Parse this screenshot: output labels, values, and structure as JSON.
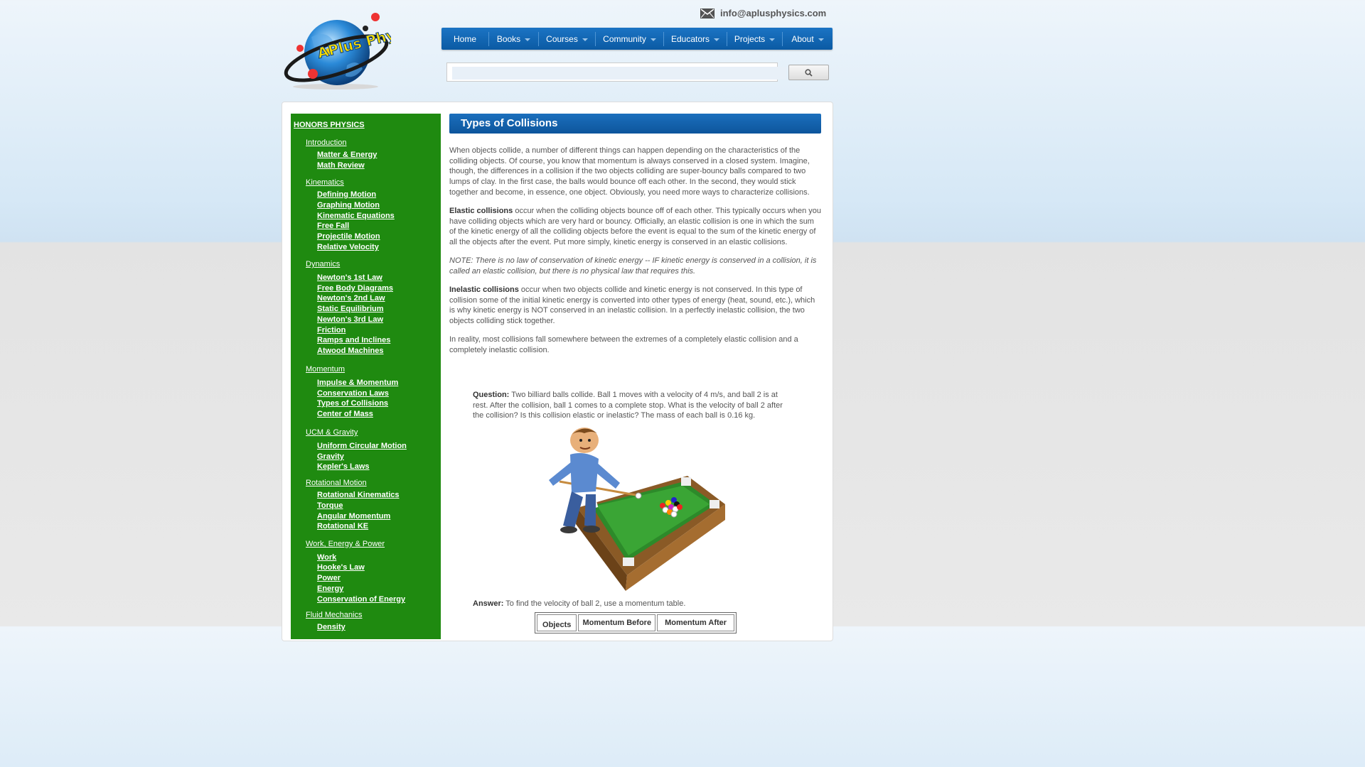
{
  "header": {
    "logo_text": "APlus Physics .com",
    "email": "info@aplusphysics.com"
  },
  "nav": {
    "items": [
      {
        "label": "Home",
        "dropdown": false
      },
      {
        "label": "Books",
        "dropdown": true
      },
      {
        "label": "Courses",
        "dropdown": true
      },
      {
        "label": "Community",
        "dropdown": true
      },
      {
        "label": "Educators",
        "dropdown": true
      },
      {
        "label": "Projects",
        "dropdown": true
      },
      {
        "label": "About",
        "dropdown": true
      }
    ]
  },
  "search": {
    "value": "",
    "placeholder": ""
  },
  "sidebar": {
    "title": "HONORS PHYSICS",
    "sections": [
      {
        "label": "Introduction",
        "items": [
          "Matter & Energy",
          "Math Review"
        ]
      },
      {
        "label": "Kinematics",
        "items": [
          "Defining Motion",
          "Graphing Motion",
          "Kinematic Equations",
          "Free Fall",
          "Projectile Motion",
          "Relative Velocity"
        ]
      },
      {
        "label": "Dynamics",
        "items": [
          "Newton's 1st Law",
          "Free Body Diagrams",
          "Newton's 2nd Law",
          "Static Equilibrium",
          "Newton's 3rd Law",
          "Friction",
          "Ramps and Inclines",
          "Atwood Machines"
        ]
      },
      {
        "label": "Momentum",
        "items": [
          "Impulse & Momentum",
          "Conservation Laws",
          "Types of Collisions",
          "Center of Mass"
        ]
      },
      {
        "label": "UCM & Gravity",
        "items": [
          "Uniform Circular Motion",
          "Gravity",
          "Kepler's Laws"
        ]
      },
      {
        "label": "Rotational Motion",
        "items": [
          "Rotational Kinematics",
          "Torque",
          "Angular Momentum",
          "Rotational KE"
        ]
      },
      {
        "label": "Work, Energy & Power",
        "items": [
          "Work",
          "Hooke's Law",
          "Power",
          "Energy",
          "Conservation of Energy"
        ]
      },
      {
        "label": "Fluid Mechanics",
        "items": [
          "Density"
        ]
      }
    ]
  },
  "main": {
    "title": "Types of Collisions",
    "intro": "When objects collide, a number of different things can happen depending on the characteristics of the colliding objects. Of course, you know that momentum is always conserved in a closed system. Imagine, though, the differences in a collision if the two objects colliding are super-bouncy balls compared to two lumps of clay. In the first case, the balls would bounce off each other. In the second, they would stick together and become, in essence, one object. Obviously, you need more ways to characterize collisions.",
    "elastic_term": "Elastic collisions",
    "elastic_text": " occur when the colliding objects bounce off of each other. This typically occurs when you have colliding objects which are very hard or bouncy. Officially, an elastic collision is one in which the sum of the kinetic energy of all the colliding objects before the event is equal to the sum of the kinetic energy of all the objects after the event. Put more simply, kinetic energy is conserved in an elastic collisions.",
    "note": "NOTE: There is no law of conservation of kinetic energy -- IF kinetic energy is conserved in a collision, it is called an elastic collision, but there is no physical law that requires this.",
    "inelastic_term": "Inelastic collisions",
    "inelastic_text": " occur when two objects collide and kinetic energy is not conserved. In this type of collision some of the initial kinetic energy is converted into other types of energy (heat, sound, etc.), which is why kinetic energy is NOT conserved in an inelastic collision. In a perfectly inelastic collision, the two objects colliding stick together.",
    "reality": "In reality, most collisions fall somewhere between the extremes of a completely elastic collision and a completely inelastic collision.",
    "question_label": "Question:",
    "question_text": " Two billiard balls collide. Ball 1 moves with a velocity of 4 m/s, and ball 2 is at rest. After the collision, ball 1 comes to a complete stop. What is the velocity of ball 2 after the collision? Is this collision elastic or inelastic? The mass of each ball is 0.16 kg.",
    "answer_label": "Answer:",
    "answer_text": " To find the velocity of ball 2, use a momentum table.",
    "table_headers": [
      "Objects",
      "Momentum Before",
      "Momentum After"
    ]
  },
  "colors": {
    "nav_blue": "#0b5aa3",
    "sidebar_green": "#1f8a10",
    "title_blue": "#1b6fbd"
  }
}
